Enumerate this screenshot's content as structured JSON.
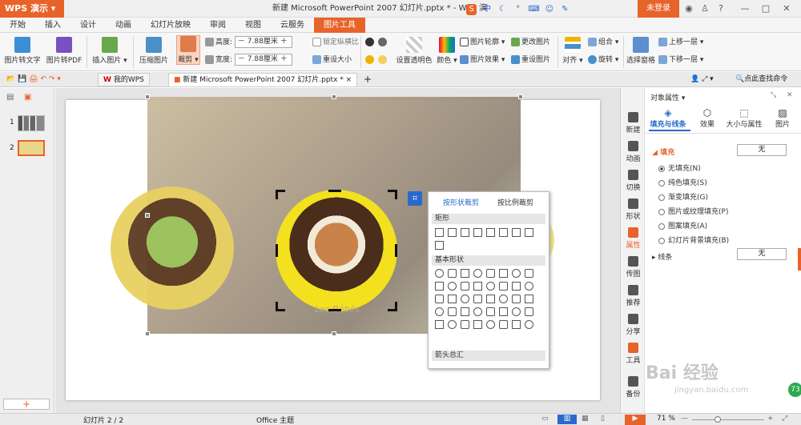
{
  "app": {
    "name": "WPS 演示",
    "title": "新建 Microsoft PowerPoint 2007 幻灯片.pptx * - WPS 演",
    "login": "未登录"
  },
  "menu": [
    "开始",
    "插入",
    "设计",
    "动画",
    "幻灯片放映",
    "审阅",
    "视图",
    "云服务",
    "图片工具"
  ],
  "ribbon": {
    "pic_to_text": "图片转文字",
    "pic_to_pdf": "图片转PDF",
    "insert_pic": "插入图片",
    "compress": "压缩图片",
    "crop": "裁剪",
    "height_label": "高度:",
    "height_value": "7.88厘米",
    "width_label": "宽度:",
    "width_value": "7.88厘米",
    "lock_ratio": "锁定纵横比",
    "reset_size": "重设大小",
    "transparent": "设置透明色",
    "color": "颜色",
    "outline": "图片轮廓",
    "effect": "图片效果",
    "change_pic": "更改图片",
    "reset_pic": "重设图片",
    "align": "对齐",
    "group": "组合",
    "rotate": "旋转",
    "select_pane": "选择窗格",
    "bring_forward": "上移一层",
    "send_backward": "下移一层"
  },
  "tabs": {
    "mywps": "我的WPS",
    "doc": "新建 Microsoft PowerPoint 2007 幻灯片.pptx *",
    "search": "点此查找命令"
  },
  "slides": {
    "numbers": [
      "1",
      "2"
    ]
  },
  "watermark": "Les Bébés",
  "crop_popup": {
    "tab_shape": "按形状裁剪",
    "tab_ratio": "按比例裁剪",
    "sec_rect": "矩形",
    "sec_basic": "基本形状",
    "sec_arrow": "箭头总汇"
  },
  "sidebar": [
    "新建",
    "动画",
    "切换",
    "形状",
    "属性",
    "传图",
    "推荐",
    "分享",
    "工具",
    "备份"
  ],
  "props": {
    "header": "对象属性",
    "tab_fill": "填充与线条",
    "tab_effect": "效果",
    "tab_size": "大小与属性",
    "tab_pic": "图片",
    "fill": "填充",
    "fill_value": "无",
    "options": [
      "无填充(N)",
      "纯色填充(S)",
      "渐变填充(G)",
      "图片或纹理填充(P)",
      "图案填充(A)",
      "幻灯片背景填充(B)"
    ],
    "line": "线条",
    "line_value": "无"
  },
  "status": {
    "slide": "幻灯片 2 / 2",
    "theme": "Office 主题",
    "zoom": "71 %"
  },
  "brand": {
    "watermark": "Bai 经验",
    "url": "jingyan.baidu.com",
    "badge": "73"
  },
  "colors": {
    "accent": "#e8632a",
    "selection": "#2a6acb"
  }
}
